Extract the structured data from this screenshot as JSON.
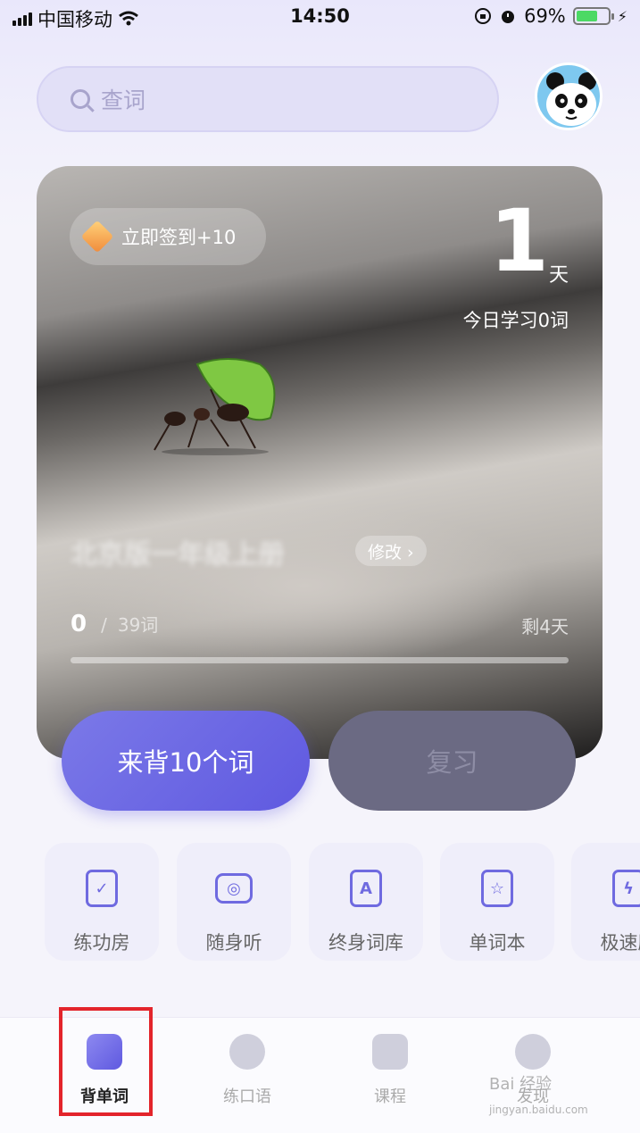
{
  "status_bar": {
    "carrier": "中国移动",
    "time": "14:50",
    "battery_text": "69%",
    "battery_level": 0.69
  },
  "search": {
    "placeholder": "查词"
  },
  "card": {
    "checkin_label": "立即签到+10",
    "streak_days": "1",
    "streak_unit": "天",
    "today_text": "今日学习0词",
    "book_name": "北京版一年级上册",
    "edit_label": "修改 ›",
    "progress_current": "0",
    "progress_separator": "/",
    "progress_total": "39词",
    "remaining": "剩4天",
    "progress_fraction": 0
  },
  "actions": {
    "learn_label": "来背10个词",
    "review_label": "复习"
  },
  "tools": [
    {
      "label": "练功房",
      "icon": "clipboard-check-icon"
    },
    {
      "label": "随身听",
      "icon": "radio-icon"
    },
    {
      "label": "终身词库",
      "icon": "word-cards-icon"
    },
    {
      "label": "单词本",
      "icon": "star-card-icon"
    },
    {
      "label": "极速刷",
      "icon": "lightning-card-icon"
    }
  ],
  "tabs": [
    {
      "label": "背单词",
      "icon": "book-icon",
      "active": true
    },
    {
      "label": "练口语",
      "icon": "speech-play-icon",
      "active": false
    },
    {
      "label": "课程",
      "icon": "bookmark-star-icon",
      "active": false
    },
    {
      "label": "发现",
      "icon": "compass-icon",
      "active": false
    }
  ],
  "watermark": {
    "text": "Bai 经验",
    "url_text": "jingyan.baidu.com"
  },
  "colors": {
    "accent": "#5f59e0",
    "highlight_box": "#e3242b",
    "battery": "#4cd964"
  }
}
